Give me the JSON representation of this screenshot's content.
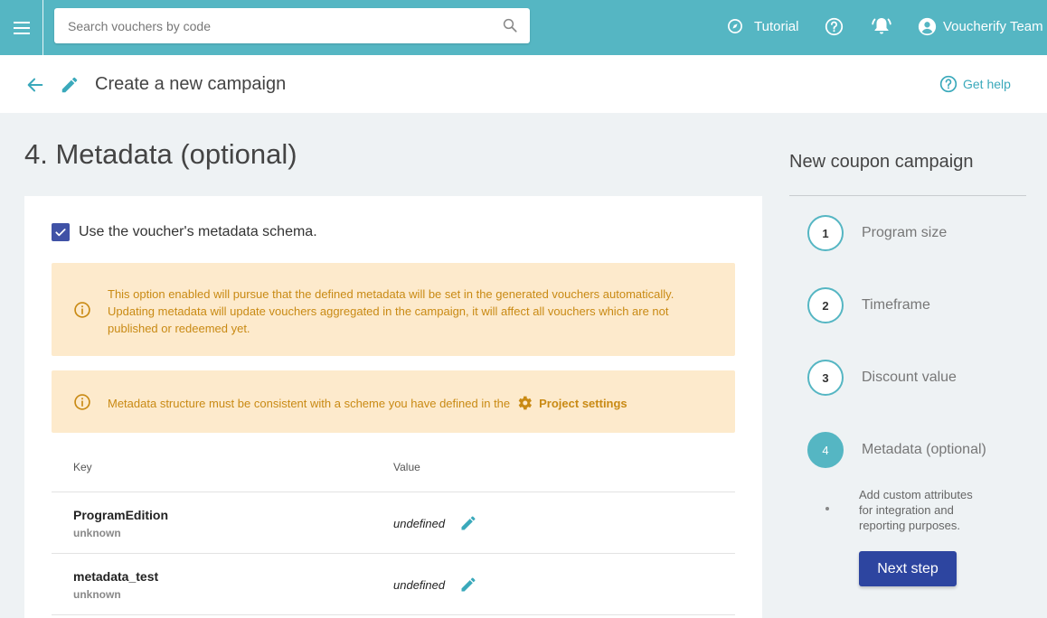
{
  "topbar": {
    "search_placeholder": "Search vouchers by code",
    "tutorial_label": "Tutorial",
    "team_label": "Voucherify Team"
  },
  "header": {
    "title": "Create a new campaign",
    "get_help_label": "Get help"
  },
  "main": {
    "section_title": "4. Metadata (optional)",
    "checkbox_label": "Use the voucher's metadata schema.",
    "checkbox_checked": true,
    "alert1_text": "This option enabled will pursue that the defined metadata will be set in the generated vouchers automatically. Updating metadata will update vouchers aggregated in the campaign, it will affect all vouchers which are not published or redeemed yet.",
    "alert2_text": "Metadata structure must be consistent with a scheme you have defined in the",
    "alert2_link": "Project settings",
    "table": {
      "headers": {
        "key": "Key",
        "value": "Value"
      },
      "rows": [
        {
          "key": "ProgramEdition",
          "type": "unknown",
          "value": "undefined"
        },
        {
          "key": "metadata_test",
          "type": "unknown",
          "value": "undefined"
        }
      ]
    }
  },
  "sidebar": {
    "title": "New coupon campaign",
    "steps": [
      {
        "number": "1",
        "label": "Program size"
      },
      {
        "number": "2",
        "label": "Timeframe"
      },
      {
        "number": "3",
        "label": "Discount value"
      },
      {
        "number": "4",
        "label": "Metadata (optional)"
      }
    ],
    "active_step_description": "Add custom attributes for integration and reporting purposes.",
    "next_button": "Next step"
  },
  "colors": {
    "topbar": "#55b6c3",
    "accent": "#3aa9bb",
    "primary_button": "#2d45a0",
    "alert_bg": "#fdeacc",
    "alert_text": "#c98a14"
  }
}
